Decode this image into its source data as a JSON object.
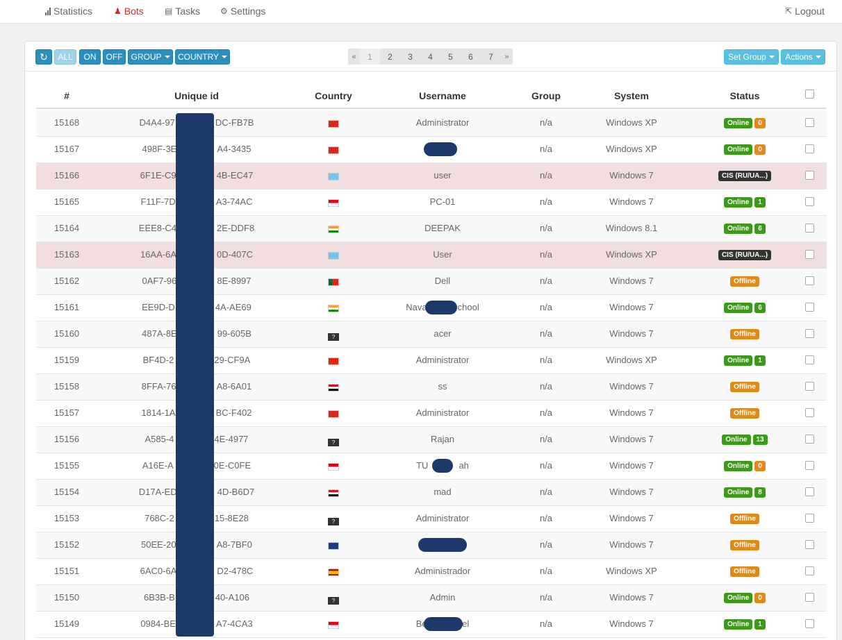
{
  "nav": {
    "statistics": "Statistics",
    "bots": "Bots",
    "tasks": "Tasks",
    "settings": "Settings",
    "logout": "Logout"
  },
  "toolbar": {
    "all": "ALL",
    "on": "ON",
    "off": "OFF",
    "group": "GROUP",
    "country": "COUNTRY",
    "set_group": "Set Group",
    "actions": "Actions",
    "refresh_icon": "refresh-icon"
  },
  "pagination": {
    "prev": "«",
    "next": "»",
    "pages": [
      "1",
      "2",
      "3",
      "4",
      "5",
      "6",
      "7"
    ],
    "current": "1"
  },
  "table": {
    "headers": {
      "num": "#",
      "uid": "Unique id",
      "country": "Country",
      "username": "Username",
      "group": "Group",
      "system": "System",
      "status": "Status"
    },
    "rows": [
      {
        "num": "15168",
        "uid": "D4A4-97",
        "uid2": "DC-FB7B",
        "flag": "vn",
        "user": "Administrator",
        "group": "n/a",
        "sys": "Windows XP",
        "status": "Online",
        "count": "0"
      },
      {
        "num": "15167",
        "uid": "498F-3E",
        "uid2": "A4-3435",
        "flag": "vn",
        "user": "",
        "group": "n/a",
        "sys": "Windows XP",
        "status": "Online",
        "count": "0"
      },
      {
        "num": "15166",
        "uid": "6F1E-C9",
        "uid2": "4B-EC47",
        "flag": "kz",
        "user": "user",
        "group": "n/a",
        "sys": "Windows 7",
        "status": "CIS (RU/UA...)",
        "count": ""
      },
      {
        "num": "15165",
        "uid": "F11F-7D",
        "uid2": "A3-74AC",
        "flag": "id",
        "user": "PC-01",
        "group": "n/a",
        "sys": "Windows 7",
        "status": "Online",
        "count": "1"
      },
      {
        "num": "15164",
        "uid": "EEE8-C4",
        "uid2": "2E-DDF8",
        "flag": "in",
        "user": "DEEPAK",
        "group": "n/a",
        "sys": "Windows 8.1",
        "status": "Online",
        "count": "6"
      },
      {
        "num": "15163",
        "uid": "16AA-6A",
        "uid2": "0D-407C",
        "flag": "kz",
        "user": "User",
        "group": "n/a",
        "sys": "Windows XP",
        "status": "CIS (RU/UA...)",
        "count": ""
      },
      {
        "num": "15162",
        "uid": "0AF7-96",
        "uid2": "8E-8997",
        "flag": "pt",
        "user": "Dell",
        "group": "n/a",
        "sys": "Windows 7",
        "status": "Offline",
        "count": ""
      },
      {
        "num": "15161",
        "uid": "EE9D-D",
        "uid2": "4A-AE69",
        "flag": "in",
        "user": "Nava",
        "user2": "chool",
        "group": "n/a",
        "sys": "Windows 7",
        "status": "Online",
        "count": "6"
      },
      {
        "num": "15160",
        "uid": "487A-8E",
        "uid2": "99-605B",
        "flag": "unknown",
        "user": "acer",
        "group": "n/a",
        "sys": "Windows 7",
        "status": "Offline",
        "count": ""
      },
      {
        "num": "15159",
        "uid": "BF4D-2",
        "uid2": "29-CF9A",
        "flag": "cn",
        "user": "Administrator",
        "group": "n/a",
        "sys": "Windows XP",
        "status": "Online",
        "count": "1"
      },
      {
        "num": "15158",
        "uid": "8FFA-76",
        "uid2": "A8-6A01",
        "flag": "eg",
        "user": "ss",
        "group": "n/a",
        "sys": "Windows 7",
        "status": "Offline",
        "count": ""
      },
      {
        "num": "15157",
        "uid": "1814-1A",
        "uid2": "BC-F402",
        "flag": "vn",
        "user": "Administrator",
        "group": "n/a",
        "sys": "Windows 7",
        "status": "Offline",
        "count": ""
      },
      {
        "num": "15156",
        "uid": "A585-4",
        "uid2": "4E-4977",
        "flag": "unknown",
        "user": "Rajan",
        "group": "n/a",
        "sys": "Windows 7",
        "status": "Online",
        "count": "13"
      },
      {
        "num": "15155",
        "uid": "A16E-A",
        "uid2": "0E-C0FE",
        "flag": "id",
        "user": "TU",
        "user2": "ah",
        "group": "n/a",
        "sys": "Windows 7",
        "status": "Online",
        "count": "0"
      },
      {
        "num": "15154",
        "uid": "D17A-ED",
        "uid2": "4D-B6D7",
        "flag": "eg",
        "user": "mad",
        "group": "n/a",
        "sys": "Windows 7",
        "status": "Online",
        "count": "8"
      },
      {
        "num": "15153",
        "uid": "768C-2",
        "uid2": "15-8E28",
        "flag": "unknown",
        "user": "Administrator",
        "group": "n/a",
        "sys": "Windows 7",
        "status": "Offline",
        "count": ""
      },
      {
        "num": "15152",
        "uid": "50EE-20",
        "uid2": "A8-7BF0",
        "flag": "au",
        "user": "",
        "group": "n/a",
        "sys": "Windows 7",
        "status": "Offline",
        "count": ""
      },
      {
        "num": "15151",
        "uid": "6AC0-6A",
        "uid2": "D2-478C",
        "flag": "es",
        "user": "Administrador",
        "group": "n/a",
        "sys": "Windows XP",
        "status": "Offline",
        "count": ""
      },
      {
        "num": "15150",
        "uid": "6B3B-B",
        "uid2": "40-A106",
        "flag": "unknown",
        "user": "Admin",
        "group": "n/a",
        "sys": "Windows 7",
        "status": "Online",
        "count": "0"
      },
      {
        "num": "15149",
        "uid": "0984-BE",
        "uid2": "A7-4CA3",
        "flag": "id",
        "user": "Be",
        "user2": "sel",
        "group": "n/a",
        "sys": "Windows 7",
        "status": "Online",
        "count": "1"
      }
    ]
  },
  "colors": {
    "online": "#3c9a1a",
    "offline": "#e08a1a",
    "cis": "#333333",
    "redaction": "#1b3a6b",
    "accent": "#2a8fbd"
  }
}
